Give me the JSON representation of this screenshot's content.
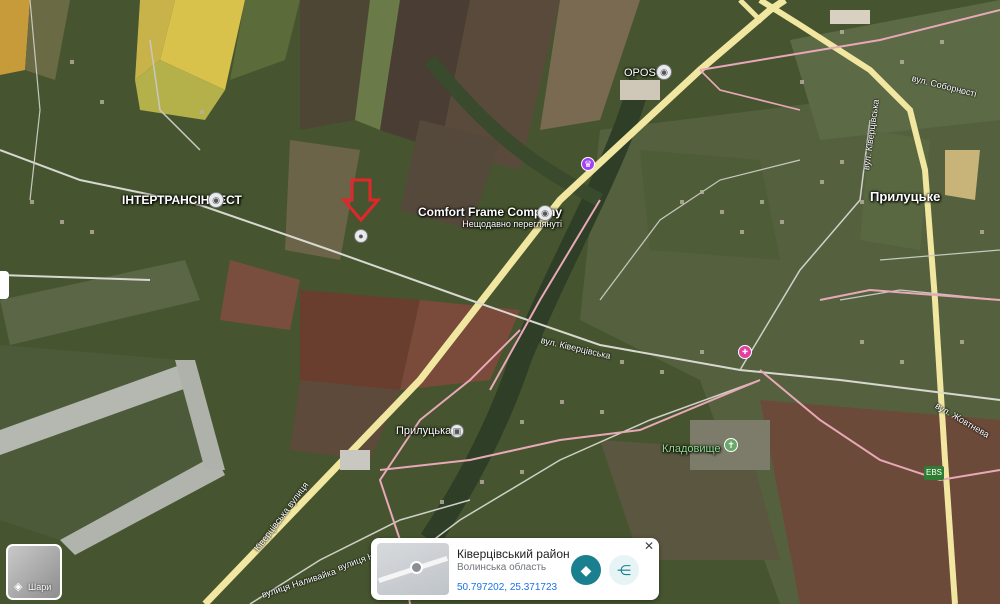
{
  "places": {
    "intertrans": "ІНТЕРТРАНСІНВЕСТ",
    "opos": "OPOS",
    "comfort": "Comfort Frame Company",
    "comfort_sub": "Нещодавно переглянуті",
    "prylutske": "Прилуцьке",
    "prylutska_stop": "Прилуцька",
    "cemetery": "Кладовище",
    "ebs": "EBS"
  },
  "streets": {
    "kivertsivska": "вул. Ківерцівська",
    "sobornosti": "вул. Соборності",
    "kivertsivska_v": "вул. Ківерцівська",
    "zhovtneva": "вул. Жовтнева",
    "kivertsivska_road": "Ківерцівська вулиця",
    "nalyvaika1": "вулиця Наливайка",
    "nalyvaika2": "вулиця Наливайка"
  },
  "layers": {
    "label": "Шари"
  },
  "card": {
    "title": "Ківерцівський район",
    "region": "Волинська область",
    "coords": "50.797202, 25.371723"
  },
  "colors": {
    "road": "#f2e7a0",
    "boundary": "#e8a8b8",
    "directions_button": "#1a7f8e",
    "marker_arrow": "#e3262b"
  }
}
